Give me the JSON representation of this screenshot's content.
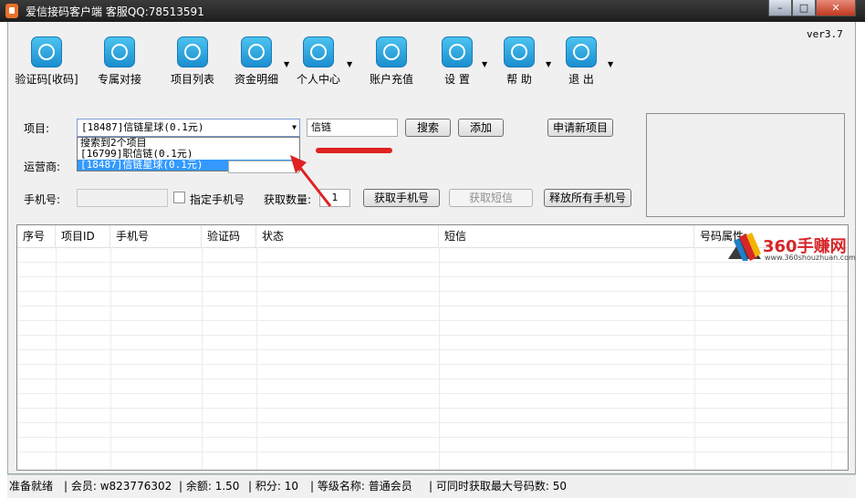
{
  "window": {
    "title": "爱信接码客户端   客服QQ:78513591",
    "min": "–",
    "max": "□",
    "close": "✕"
  },
  "version": "ver3.7",
  "toolbar": [
    {
      "label": "验证码[收码]",
      "icon": "sms-code-icon",
      "dropdown": false
    },
    {
      "label": "专属对接",
      "icon": "link-icon",
      "dropdown": false
    },
    {
      "label": "项目列表",
      "icon": "list-icon",
      "dropdown": false
    },
    {
      "label": "资金明细",
      "icon": "document-icon",
      "dropdown": true
    },
    {
      "label": "个人中心",
      "icon": "id-card-icon",
      "dropdown": true
    },
    {
      "label": "账户充值",
      "icon": "money-bag-icon",
      "dropdown": false
    },
    {
      "label": "设 置",
      "icon": "gear-icon",
      "dropdown": true
    },
    {
      "label": "帮 助",
      "icon": "help-icon",
      "dropdown": true
    },
    {
      "label": "退 出",
      "icon": "power-icon",
      "dropdown": true
    }
  ],
  "form": {
    "project_label": "项目:",
    "project_selected": "[18487]信链星球(0.1元)",
    "dropdown_items": [
      "搜索到2个项目",
      "[16799]职信链(0.1元)",
      "[18487]信链星球(0.1元)"
    ],
    "search_value": "信链",
    "search_button": "搜索",
    "add_button": "添加",
    "apply_button": "申请新项目",
    "carrier_label": "运营商:",
    "phone_label": "手机号:",
    "phone_value": "",
    "specify_phone_label": "指定手机号",
    "fetch_count_label": "获取数量:",
    "fetch_count_value": "1",
    "get_phone_button": "获取手机号",
    "get_sms_button": "获取短信",
    "release_all_button": "释放所有手机号"
  },
  "table": {
    "columns": [
      "序号",
      "项目ID",
      "手机号",
      "验证码",
      "状态",
      "短信",
      "号码属性"
    ],
    "rows": []
  },
  "watermark": {
    "text": "360手赚网",
    "url": "www.360shouzhuan.com"
  },
  "status": {
    "ready": "准备就绪",
    "member": "| 会员:  w823776302",
    "balance": "| 余额:  1.50",
    "points": "| 积分:  10",
    "level": "| 等级名称:  普通会员",
    "max_fetch": "| 可同时获取最大号码数:    50"
  },
  "colors": {
    "accent": "#1b8ed0",
    "selection": "#3399ff",
    "annotation": "#e02222"
  }
}
